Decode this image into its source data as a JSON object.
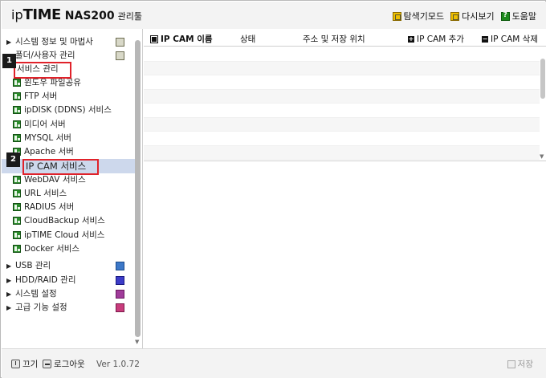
{
  "header": {
    "logo_ip": "ip",
    "logo_time": "TIME",
    "logo_model": "NAS200",
    "logo_tool": "관리툴",
    "nav": [
      {
        "label": "탐색기모드",
        "icon": "explorer-icon"
      },
      {
        "label": "다시보기",
        "icon": "refresh-icon"
      },
      {
        "label": "도움말",
        "icon": "help-icon"
      }
    ]
  },
  "sidebar": {
    "top_items": [
      {
        "label": "시스템 정보 및 마법사",
        "icon": "system-info-icon"
      },
      {
        "label": "폴더/사용자 관리",
        "icon": "folder-user-icon"
      }
    ],
    "service_group": {
      "label": "서비스 관리",
      "children": [
        "윈도우 파일공유",
        "FTP 서버",
        "ipDISK (DDNS) 서비스",
        "미디어 서버",
        "MYSQL 서버",
        "Apache 서버",
        "IP CAM 서비스",
        "WebDAV 서비스",
        "URL 서비스",
        "RADIUS 서버",
        "CloudBackup 서비스",
        "ipTIME Cloud 서비스",
        "Docker 서비스"
      ],
      "selected": "IP CAM 서비스"
    },
    "bottom_items": [
      {
        "label": "USB 관리",
        "icon": "usb-icon",
        "color": "#3c78c8"
      },
      {
        "label": "HDD/RAID 관리",
        "icon": "hdd-icon",
        "color": "#3c3cc8"
      },
      {
        "label": "시스템 설정",
        "icon": "system-settings-icon",
        "color": "#a03c9a"
      },
      {
        "label": "고급 기능 설정",
        "icon": "advanced-settings-icon",
        "color": "#c83c7c"
      }
    ],
    "markers": [
      "1",
      "2"
    ]
  },
  "table": {
    "columns": [
      "IP CAM 이름",
      "상태",
      "주소 및 저장 위치"
    ],
    "add_label": "IP CAM 추가",
    "delete_label": "IP CAM 삭제",
    "rows": []
  },
  "footer": {
    "power_label": "끄기",
    "logout_label": "로그아웃",
    "version": "Ver 1.0.72",
    "save_label": "저장"
  },
  "colors": {
    "highlight_box": "#e0222a",
    "selected_row": "#cdd8ec",
    "header_bg": "#f3f3f3"
  }
}
